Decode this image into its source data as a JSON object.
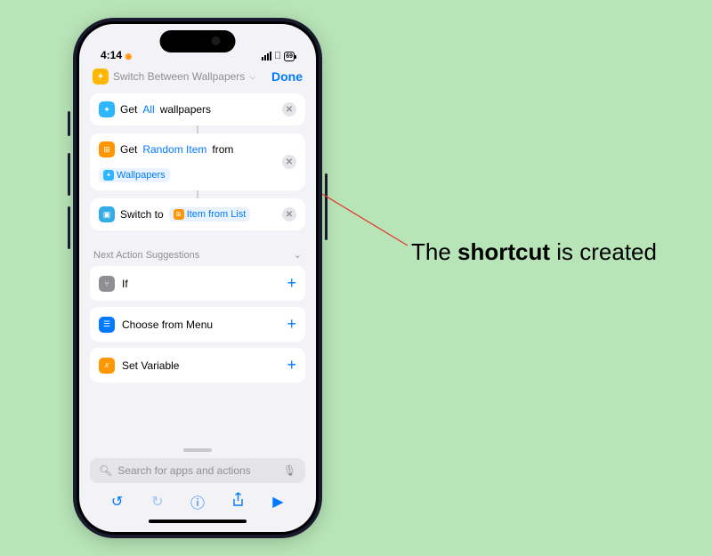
{
  "status": {
    "time": "4:14",
    "recording": "◉",
    "battery": "69"
  },
  "header": {
    "title": "Switch Between Wallpapers",
    "done": "Done"
  },
  "actions": {
    "a1": {
      "word1": "Get",
      "param": "All",
      "word2": "wallpapers"
    },
    "a2": {
      "word1": "Get",
      "param": "Random Item",
      "word2": "from",
      "pill": "Wallpapers"
    },
    "a3": {
      "word1": "Switch to",
      "pill": "Item from List"
    }
  },
  "suggest": {
    "title": "Next Action Suggestions",
    "s1": "If",
    "s2": "Choose from Menu",
    "s3": "Set Variable"
  },
  "search": {
    "placeholder": "Search for apps and actions"
  },
  "annotation": {
    "pre": "The ",
    "bold": "shortcut",
    "post": " is created"
  }
}
